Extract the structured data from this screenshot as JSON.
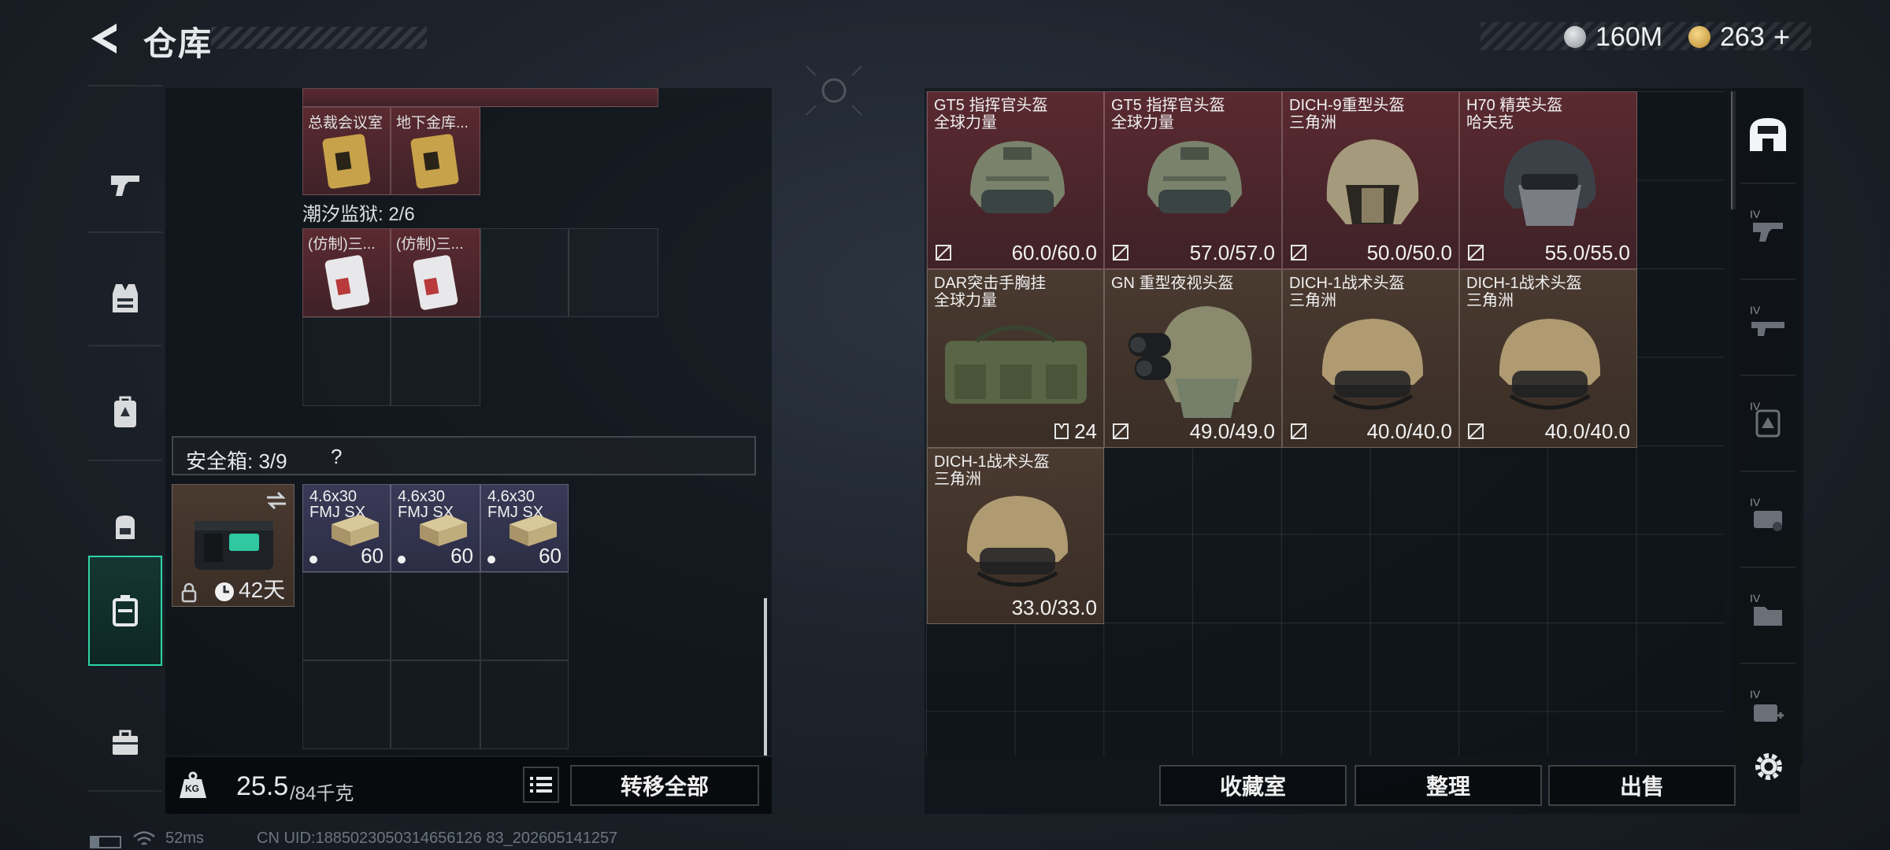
{
  "header": {
    "title": "仓库",
    "currencies": [
      {
        "icon": "silver-coin-icon",
        "value": "160M"
      },
      {
        "icon": "gold-coin-icon",
        "value": "263"
      }
    ],
    "add_symbol": "+"
  },
  "left_nav": [
    {
      "icon": "gun-icon",
      "active": false
    },
    {
      "icon": "vest-icon",
      "active": false
    },
    {
      "icon": "backpack-icon",
      "active": false
    },
    {
      "icon": "bag-icon",
      "active": false
    },
    {
      "icon": "safe-box-icon",
      "active": true
    },
    {
      "icon": "toolbox-icon",
      "active": false
    }
  ],
  "left_panel": {
    "keycards": [
      {
        "label": "总裁会议室"
      },
      {
        "label": "地下金库..."
      }
    ],
    "prison_label": "潮汐监狱: 2/6",
    "prison_cards": [
      {
        "label": "(仿制)三..."
      },
      {
        "label": "(仿制)三..."
      }
    ],
    "safe_box": {
      "label": "安全箱: 3/9",
      "help": "?",
      "duration": "42天",
      "items": [
        {
          "name_line1": "4.6x30",
          "name_line2": "FMJ SX",
          "count": "60"
        },
        {
          "name_line1": "4.6x30",
          "name_line2": "FMJ SX",
          "count": "60"
        },
        {
          "name_line1": "4.6x30",
          "name_line2": "FMJ SX",
          "count": "60"
        }
      ]
    },
    "weight": {
      "current": "25.5",
      "max": "/84千克",
      "icon_label": "KG"
    },
    "transfer_all": "转移全部"
  },
  "right_panel": {
    "items": [
      {
        "name": "GT5 指挥官头盔",
        "sub": "全球力量",
        "durability": "60.0/60.0",
        "rarity": "red"
      },
      {
        "name": "GT5 指挥官头盔",
        "sub": "全球力量",
        "durability": "57.0/57.0",
        "rarity": "red"
      },
      {
        "name": "DICH-9重型头盔",
        "sub": "三角洲",
        "durability": "50.0/50.0",
        "rarity": "red"
      },
      {
        "name": "H70 精英头盔",
        "sub": "哈夫克",
        "durability": "55.0/55.0",
        "rarity": "red"
      },
      {
        "name": "DAR突击手胸挂",
        "sub": "全球力量",
        "durability": "24",
        "rarity": "brown"
      },
      {
        "name": "GN 重型夜视头盔",
        "sub": "",
        "durability": "49.0/49.0",
        "rarity": "brown"
      },
      {
        "name": "DICH-1战术头盔",
        "sub": "三角洲",
        "durability": "40.0/40.0",
        "rarity": "brown"
      },
      {
        "name": "DICH-1战术头盔",
        "sub": "三角洲",
        "durability": "40.0/40.0",
        "rarity": "brown"
      },
      {
        "name": "DICH-1战术头盔",
        "sub": "三角洲",
        "durability": "33.0/33.0",
        "rarity": "brown"
      }
    ],
    "buttons": {
      "collection": "收藏室",
      "organize": "整理",
      "sell": "出售"
    }
  },
  "right_nav": [
    {
      "icon": "helmet-tab-icon",
      "active": true
    },
    {
      "icon": "tier4-gun-icon",
      "label": "IV"
    },
    {
      "icon": "tier4-rifle-icon",
      "label": "IV"
    },
    {
      "icon": "tier4-armor-icon",
      "label": "IV"
    },
    {
      "icon": "tier4-key-icon",
      "label": "IV"
    },
    {
      "icon": "tier4-folder-icon",
      "label": "IV"
    },
    {
      "icon": "tier4-medkit-icon",
      "label": "IV"
    }
  ],
  "footer": {
    "ping": "52ms",
    "uid": "CN UID:1885023050314656126 83_202605141257"
  },
  "colors": {
    "accent": "#2fd4a8",
    "red_rarity": "#5a2a30",
    "brown_rarity": "#4a3a30",
    "purple_rarity": "#3a3a58"
  }
}
